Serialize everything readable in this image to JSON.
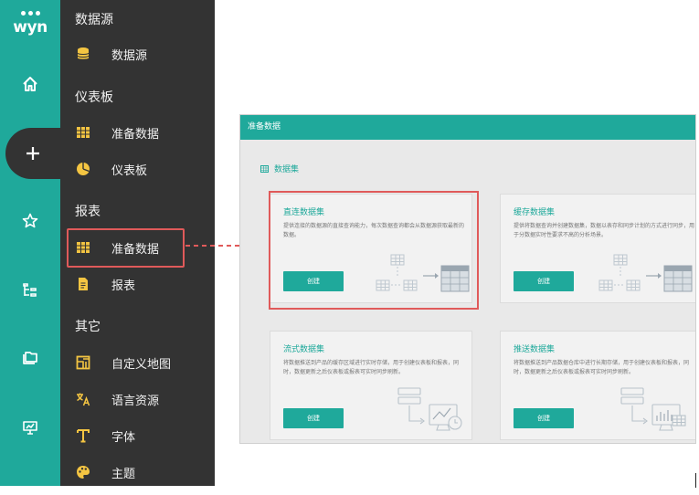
{
  "brand": {
    "logo_text": "wyn"
  },
  "rail": {
    "items": [
      {
        "name": "home-icon"
      },
      {
        "name": "plus-icon",
        "active": true
      },
      {
        "name": "star-icon"
      },
      {
        "name": "tree-icon"
      },
      {
        "name": "folder-icon"
      },
      {
        "name": "monitor-icon"
      }
    ]
  },
  "menu": {
    "sections": [
      {
        "title": "数据源",
        "items": [
          {
            "label": "数据源",
            "icon": "database-icon"
          }
        ]
      },
      {
        "title": "仪表板",
        "items": [
          {
            "label": "准备数据",
            "icon": "table-icon"
          },
          {
            "label": "仪表板",
            "icon": "pie-chart-icon"
          }
        ]
      },
      {
        "title": "报表",
        "items": [
          {
            "label": "准备数据",
            "icon": "table-icon",
            "highlighted": true
          },
          {
            "label": "报表",
            "icon": "document-icon"
          }
        ]
      },
      {
        "title": "其它",
        "items": [
          {
            "label": "自定义地图",
            "icon": "map-icon"
          },
          {
            "label": "语言资源",
            "icon": "translate-icon"
          },
          {
            "label": "字体",
            "icon": "font-icon"
          },
          {
            "label": "主题",
            "icon": "palette-icon"
          }
        ]
      }
    ]
  },
  "panel": {
    "header": "准备数据",
    "dataset_label": "数据集",
    "cards": [
      {
        "title": "直连数据集",
        "desc": "提供连接的数据源的直接查询能力，每次数据查询都会从数据源获取最新的数据。",
        "button": "创建"
      },
      {
        "title": "缓存数据集",
        "desc": "提供将数据查询并创建数据集，数据以表存和同步计划的方式进行同步，用于分数据实时性要求不高的分析场景。",
        "button": "创建"
      },
      {
        "title": "流式数据集",
        "desc": "将数据推送到产品的缓存区域进行实时存储，用于创建仪表板和报表，同时，数据更新之后仪表板或报表可实时同步刷新。",
        "button": "创建"
      },
      {
        "title": "推送数据集",
        "desc": "将数据推送到产品数据仓库中进行长期存储，用于创建仪表板和报表，同时，数据更新之后仪表板或报表可实时同步刷新。",
        "button": "创建"
      }
    ]
  },
  "colors": {
    "accent": "#1fa99b",
    "menu_bg": "#333333",
    "highlight": "#e05a5a",
    "icon_yellow": "#f4c542"
  }
}
